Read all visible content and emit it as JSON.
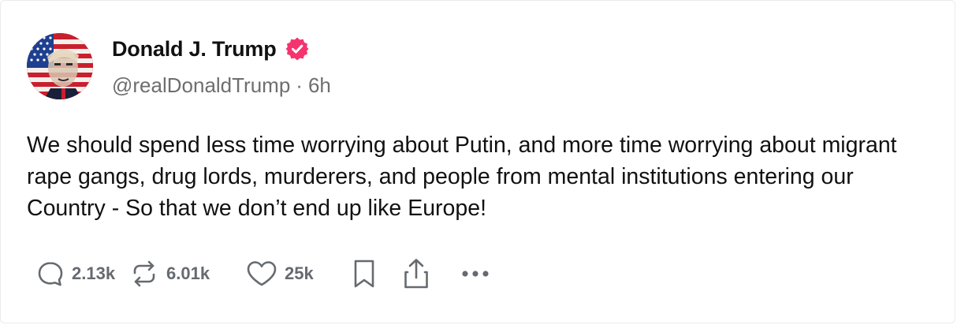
{
  "post": {
    "author": {
      "display_name": "Donald J. Trump",
      "handle": "@realDonaldTrump",
      "verified": true,
      "avatar_icon": "avatar-portrait-flag"
    },
    "separator": "·",
    "time_ago": "6h",
    "text": "We should spend less time worrying about Putin, and more time worrying about migrant rape gangs, drug lords, murderers, and people from mental institutions entering our Country - So that we don’t end up like Europe!",
    "actions": {
      "replies": {
        "icon": "reply-icon",
        "count": "2.13k"
      },
      "reposts": {
        "icon": "repost-icon",
        "count": "6.01k"
      },
      "likes": {
        "icon": "heart-icon",
        "count": "25k"
      },
      "bookmark": {
        "icon": "bookmark-icon"
      },
      "share": {
        "icon": "share-icon"
      },
      "more": {
        "icon": "more-icon"
      }
    }
  },
  "colors": {
    "verified_badge": "#f5346f",
    "text_primary": "#111111",
    "text_secondary": "#6e6e6e",
    "action_gray": "#666a70",
    "card_border": "#ebebeb"
  }
}
